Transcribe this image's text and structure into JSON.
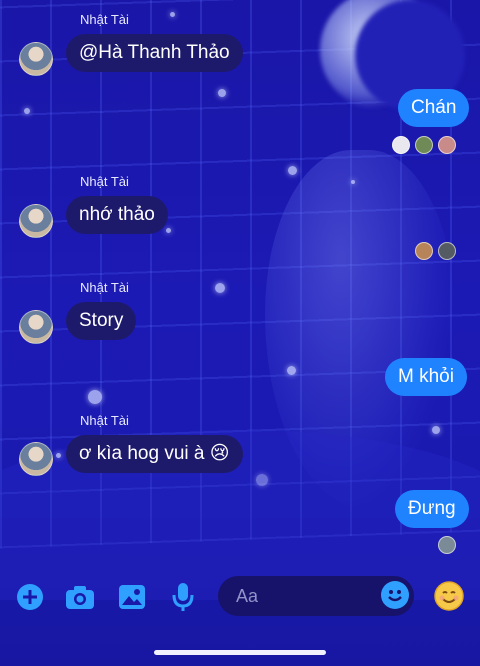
{
  "messages": [
    {
      "sender": "Nhật Tài",
      "text": "@Hà Thanh Thảo"
    },
    {
      "sender": "Nhật Tài",
      "text": "nhớ thảo"
    },
    {
      "sender": "Nhật Tài",
      "text": "Story"
    },
    {
      "sender": "Nhật Tài",
      "text": "ơ kìa hog vui à 😢"
    }
  ],
  "outgoing": [
    {
      "text": "Chán"
    },
    {
      "text": "M khỏi"
    },
    {
      "text": "Đưng"
    }
  ],
  "composer": {
    "placeholder": "Aa",
    "icons": [
      "plus-icon",
      "camera-icon",
      "image-icon",
      "microphone-icon",
      "emoji-icon",
      "sticker-emoji-icon"
    ]
  },
  "colors": {
    "background": "#1c1ab4",
    "incoming_bubble": "#1e1a6b",
    "outgoing_bubble": "#1f83ff",
    "accent": "#2fa0ff"
  }
}
